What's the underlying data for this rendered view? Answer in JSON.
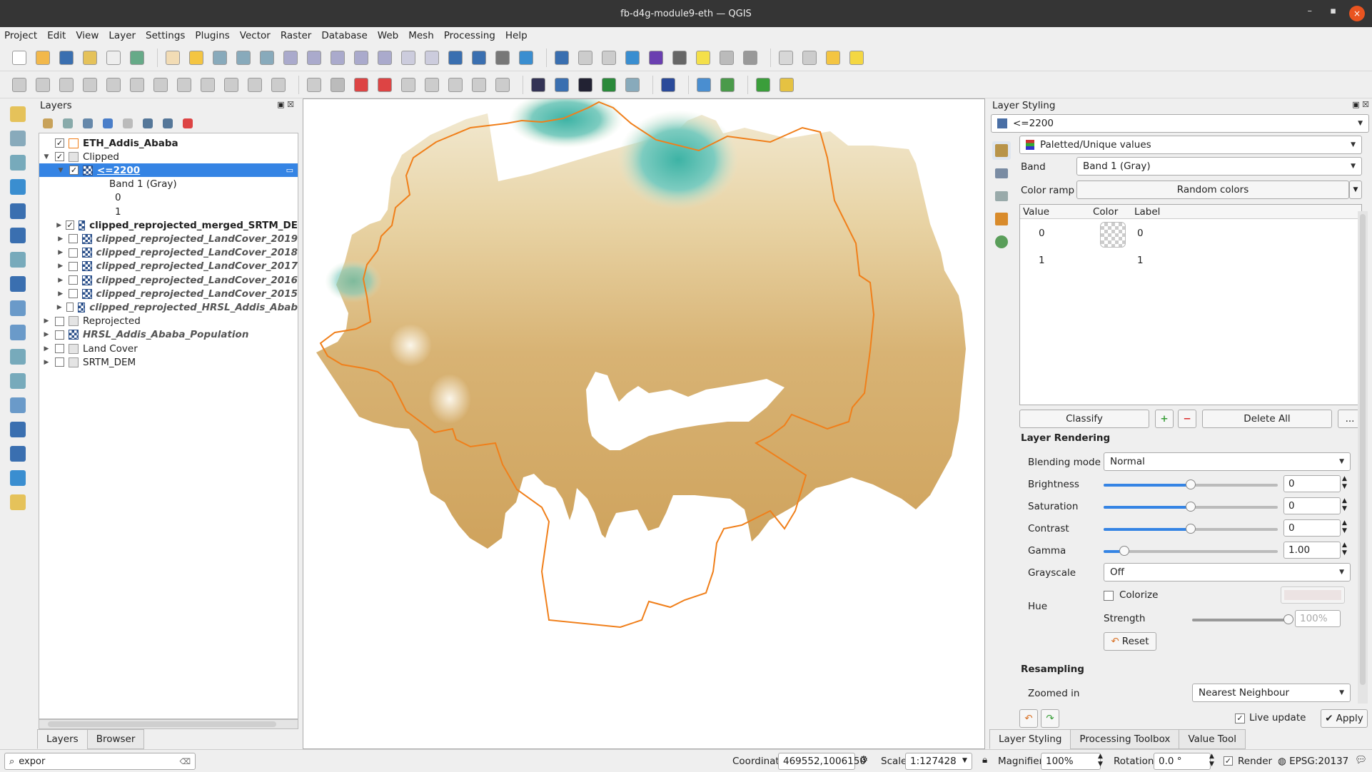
{
  "window": {
    "title": "fb-d4g-module9-eth — QGIS",
    "close_glyph": "×",
    "min_glyph": "–",
    "max_glyph": "▪"
  },
  "menu": [
    "Project",
    "Edit",
    "View",
    "Layer",
    "Settings",
    "Plugins",
    "Vector",
    "Raster",
    "Database",
    "Web",
    "Mesh",
    "Processing",
    "Help"
  ],
  "layers_panel": {
    "title": "Layers",
    "items": [
      {
        "label": "ETH_Addis_Ababa",
        "checked": true,
        "style": "bold",
        "indent": 0,
        "arrow": "",
        "icon": "polygon"
      },
      {
        "label": "Clipped",
        "checked": true,
        "style": "",
        "indent": 0,
        "arrow": "▼",
        "icon": "group"
      },
      {
        "label": "<=2200",
        "checked": true,
        "style": "selected",
        "indent": 1,
        "arrow": "▼",
        "icon": "raster"
      },
      {
        "label": "Band 1 (Gray)",
        "checked": null,
        "style": "",
        "indent": 2,
        "arrow": "",
        "icon": ""
      },
      {
        "label": "0",
        "checked": null,
        "style": "",
        "indent": 3,
        "arrow": "",
        "icon": ""
      },
      {
        "label": "1",
        "checked": null,
        "style": "",
        "indent": 3,
        "arrow": "",
        "icon": ""
      },
      {
        "label": "clipped_reprojected_merged_SRTM_DE",
        "checked": true,
        "style": "bold",
        "indent": 1,
        "arrow": "▶",
        "icon": "raster"
      },
      {
        "label": "clipped_reprojected_LandCover_2019",
        "checked": false,
        "style": "italic",
        "indent": 1,
        "arrow": "▶",
        "icon": "raster"
      },
      {
        "label": "clipped_reprojected_LandCover_2018",
        "checked": false,
        "style": "italic",
        "indent": 1,
        "arrow": "▶",
        "icon": "raster"
      },
      {
        "label": "clipped_reprojected_LandCover_2017",
        "checked": false,
        "style": "italic",
        "indent": 1,
        "arrow": "▶",
        "icon": "raster"
      },
      {
        "label": "clipped_reprojected_LandCover_2016",
        "checked": false,
        "style": "italic",
        "indent": 1,
        "arrow": "▶",
        "icon": "raster"
      },
      {
        "label": "clipped_reprojected_LandCover_2015",
        "checked": false,
        "style": "italic",
        "indent": 1,
        "arrow": "▶",
        "icon": "raster"
      },
      {
        "label": "clipped_reprojected_HRSL_Addis_Abab",
        "checked": false,
        "style": "italic",
        "indent": 1,
        "arrow": "▶",
        "icon": "raster"
      },
      {
        "label": "Reprojected",
        "checked": false,
        "style": "",
        "indent": 0,
        "arrow": "▶",
        "icon": "group"
      },
      {
        "label": "HRSL_Addis_Ababa_Population",
        "checked": false,
        "style": "italic",
        "indent": 0,
        "arrow": "▶",
        "icon": "raster"
      },
      {
        "label": "Land Cover",
        "checked": false,
        "style": "",
        "indent": 0,
        "arrow": "▶",
        "icon": "group"
      },
      {
        "label": "SRTM_DEM",
        "checked": false,
        "style": "",
        "indent": 0,
        "arrow": "▶",
        "icon": "group"
      }
    ],
    "tabs": [
      "Layers",
      "Browser"
    ],
    "search_value": "expor",
    "check_glyph": "✓"
  },
  "styling": {
    "title": "Layer Styling",
    "layer_select": "<=2200",
    "renderer": "Paletted/Unique values",
    "band_label": "Band",
    "band_value": "Band 1 (Gray)",
    "ramp_label": "Color ramp",
    "ramp_value": "Random colors",
    "table_headers": [
      "Value",
      "Color",
      "Label"
    ],
    "table_rows": [
      {
        "value": "0",
        "label": "0"
      },
      {
        "value": "1",
        "label": "1"
      }
    ],
    "classify": "Classify",
    "delete_all": "Delete All",
    "more": "...",
    "rendering_title": "Layer Rendering",
    "blending_label": "Blending mode",
    "blending_value": "Normal",
    "brightness_label": "Brightness",
    "brightness_value": "0",
    "saturation_label": "Saturation",
    "saturation_value": "0",
    "contrast_label": "Contrast",
    "contrast_value": "0",
    "gamma_label": "Gamma",
    "gamma_value": "1.00",
    "grayscale_label": "Grayscale",
    "grayscale_value": "Off",
    "hue_label": "Hue",
    "colorize_label": "Colorize",
    "strength_label": "Strength",
    "strength_value": "100%",
    "reset": "Reset",
    "resampling_title": "Resampling",
    "zoomed_in_label": "Zoomed in",
    "zoomed_in_value": "Nearest Neighbour",
    "live_update": "Live update",
    "apply": "Apply",
    "tabs": [
      "Layer Styling",
      "Processing Toolbox",
      "Value Tool"
    ]
  },
  "status": {
    "coordinate_label": "Coordinate",
    "coordinate_value": "469552,1006150",
    "scale_label": "Scale",
    "scale_value": "1:127428",
    "magnifier_label": "Magnifier",
    "magnifier_value": "100%",
    "rotation_label": "Rotation",
    "rotation_value": "0.0 °",
    "render_label": "Render",
    "crs": "EPSG:20137"
  },
  "colors": {
    "accent": "#3584e4",
    "boundary": "#f07f1a",
    "dem_low": "#d2a965",
    "dem_high": "#3fb5a6",
    "title_close": "#e95420"
  }
}
